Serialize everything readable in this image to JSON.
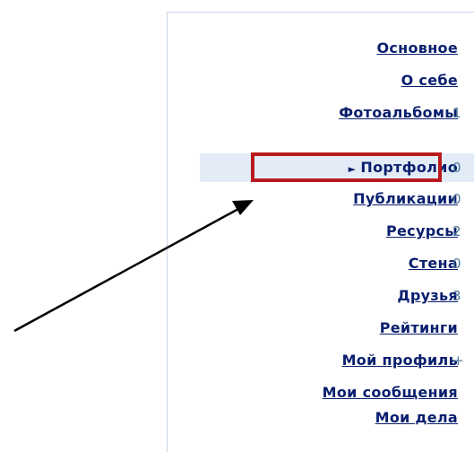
{
  "menu": {
    "items": [
      {
        "label": "Основное",
        "count": ""
      },
      {
        "label": "О себе",
        "count": ""
      },
      {
        "label": "Фотоальбомы",
        "count": "1"
      },
      {
        "label": "Портфолио",
        "count": "0",
        "active": true
      },
      {
        "label": "Публикации",
        "count": "0"
      },
      {
        "label": "Ресурсы",
        "count": "2"
      },
      {
        "label": "Стена",
        "count": "0"
      },
      {
        "label": "Друзья",
        "count": "3"
      },
      {
        "label": "Рейтинги",
        "count": ""
      },
      {
        "label": "Мой профиль",
        "count": "+"
      },
      {
        "label": "Мои сообщения",
        "count": ""
      },
      {
        "label": "Мои дела",
        "count": ""
      }
    ]
  },
  "colors": {
    "link": "#0a1f6e",
    "count": "#4f7a9a",
    "active_bg": "#e3ecf6",
    "highlight": "#b81a1e"
  },
  "icons": {
    "active_pointer": "pointer-triangle-icon",
    "annotation": "annotation-arrow-icon"
  }
}
